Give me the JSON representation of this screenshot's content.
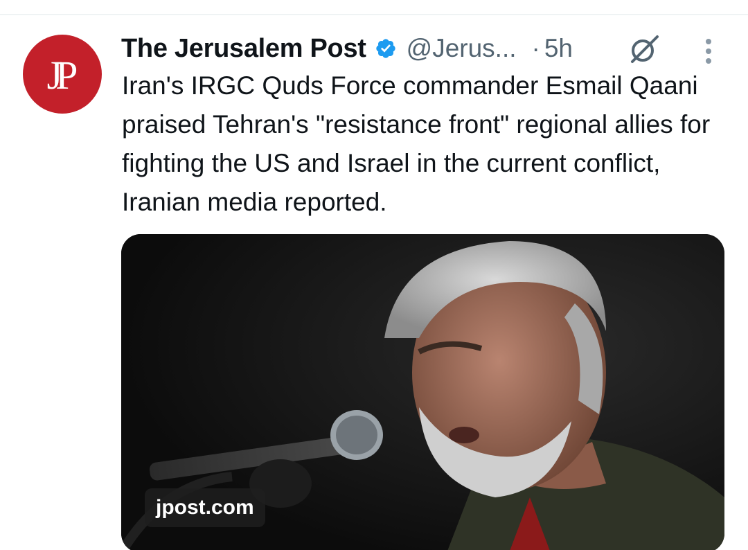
{
  "tweet": {
    "avatar_text": "JP",
    "author_name": "The Jerusalem Post",
    "handle": "@Jerus...",
    "separator": "·",
    "time": "5h",
    "text": "Iran's IRGC Quds Force commander Esmail Qaani praised Tehran's \"resistance front\" regional allies for fighting the US and Israel in the current conflict, Iranian media reported.",
    "icons": {
      "verified": "verified-badge-icon",
      "grok": "grok-icon",
      "more": "more-vertical-icon"
    }
  },
  "media": {
    "source_label": "jpost.com",
    "description": "photo"
  },
  "colors": {
    "avatar_bg": "#c3202a",
    "verified": "#1d9bf0",
    "secondary_text": "#536471",
    "primary_text": "#0f1419"
  }
}
